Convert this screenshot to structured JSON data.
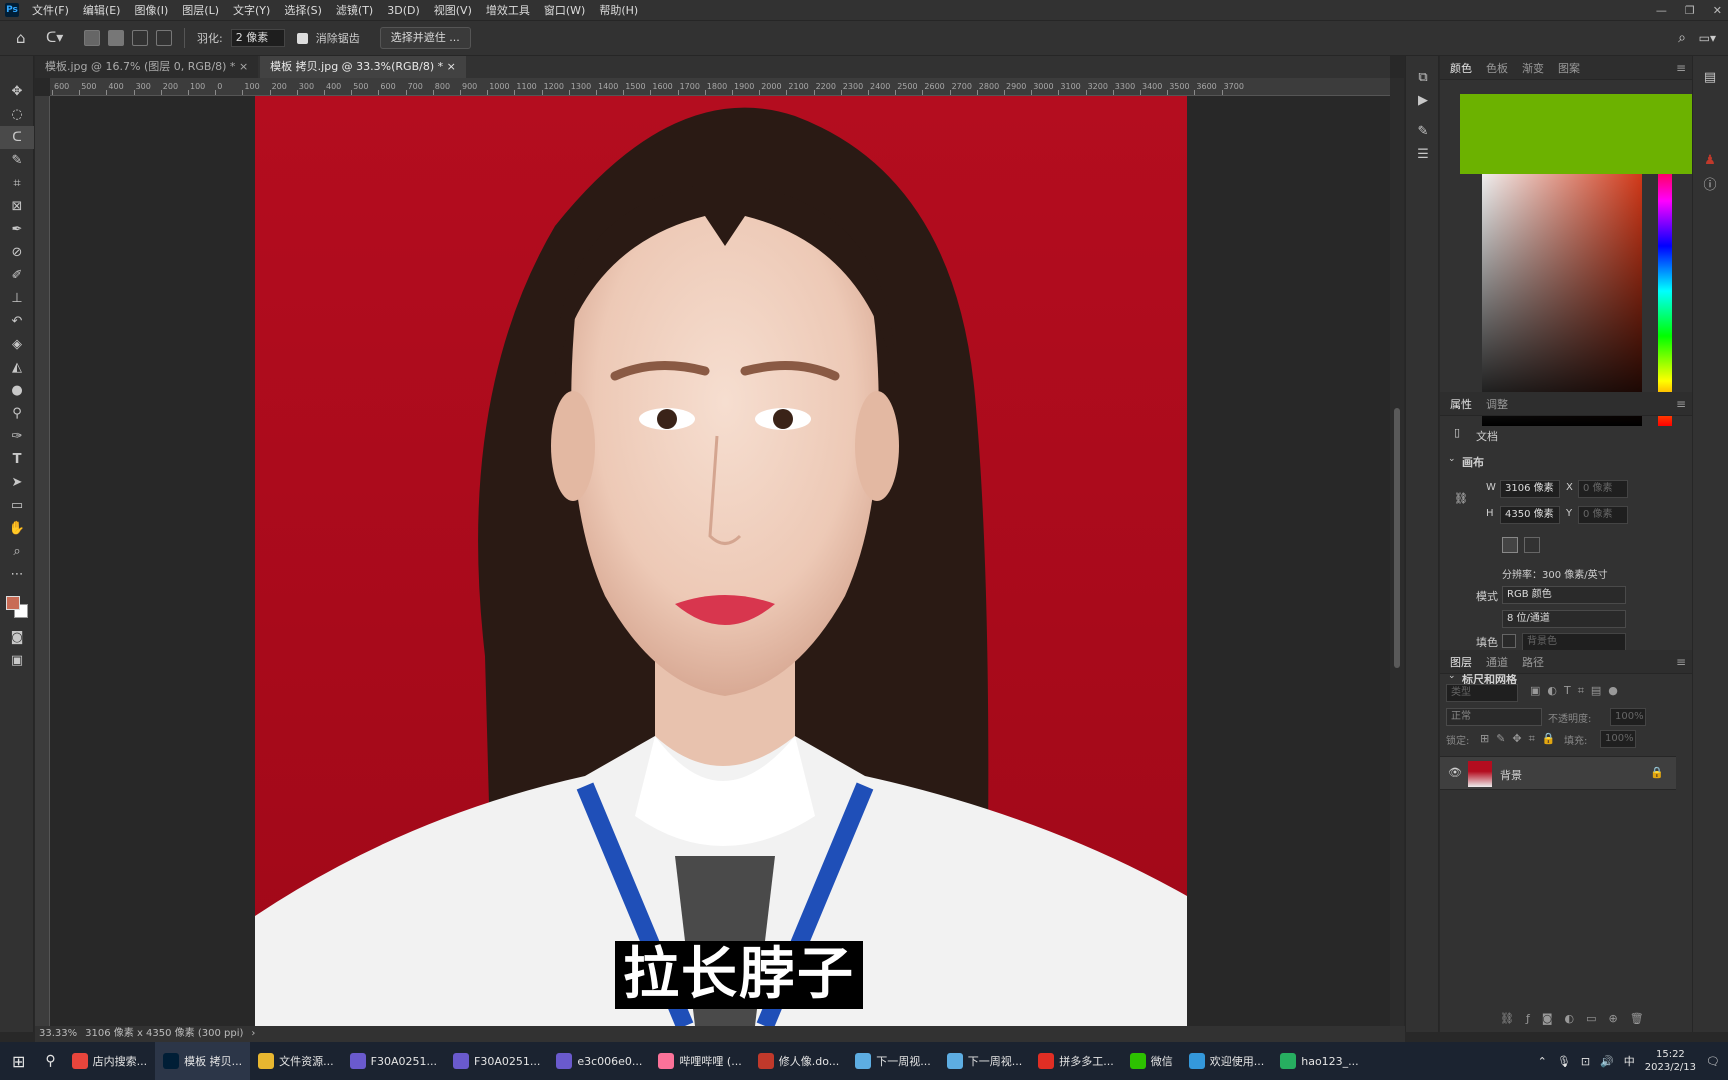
{
  "app": {
    "logo": "Ps"
  },
  "menu": [
    "文件(F)",
    "编辑(E)",
    "图像(I)",
    "图层(L)",
    "文字(Y)",
    "选择(S)",
    "滤镜(T)",
    "3D(D)",
    "视图(V)",
    "增效工具",
    "窗口(W)",
    "帮助(H)"
  ],
  "options": {
    "feather_label": "羽化:",
    "feather_value": "2 像素",
    "antialias_label": "消除锯齿",
    "select_mask_button": "选择并遮住 ..."
  },
  "tabs": [
    {
      "label": "模板.jpg @ 16.7% (图层 0, RGB/8) *"
    },
    {
      "label": "模板 拷贝.jpg @ 33.3%(RGB/8) *"
    }
  ],
  "ruler_h": [
    "600",
    "500",
    "400",
    "300",
    "200",
    "100",
    "0",
    "100",
    "200",
    "300",
    "400",
    "500",
    "600",
    "700",
    "800",
    "900",
    "1000",
    "1100",
    "1200",
    "1300",
    "1400",
    "1500",
    "1600",
    "1700",
    "1800",
    "1900",
    "2000",
    "2100",
    "2200",
    "2300",
    "2400",
    "2500",
    "2600",
    "2700",
    "2800",
    "2900",
    "3000",
    "3100",
    "3200",
    "3300",
    "3400",
    "3500",
    "3600",
    "3700"
  ],
  "subtitle": "拉长脖子",
  "status": {
    "zoom": "33.33%",
    "doc_info": "3106 像素 x 4350 像素 (300 ppi)"
  },
  "color_panel": {
    "tabs": [
      "颜色",
      "色板",
      "渐变",
      "图案"
    ],
    "overlay_color": "#6cb200"
  },
  "properties": {
    "tabs": [
      "属性",
      "调整"
    ],
    "doc_label": "文档",
    "canvas_section": "画布",
    "w_label": "W",
    "w_value": "3106 像素",
    "h_label": "H",
    "h_value": "4350 像素",
    "x_label": "X",
    "x_value": "0 像素",
    "y_label": "Y",
    "y_value": "0 像素",
    "resolution": "分辨率：300 像素/英寸",
    "mode_label": "模式",
    "mode_value": "RGB 颜色",
    "depth_value": "8 位/通道",
    "fill_label": "填色",
    "fill_value": "背景色",
    "rulers_section": "标尺和网格"
  },
  "layers": {
    "tabs": [
      "图层",
      "通道",
      "路径"
    ],
    "search_placeholder": "类型",
    "blend_mode": "正常",
    "opacity_label": "不透明度:",
    "opacity_value": "100%",
    "lock_label": "锁定:",
    "fill_label": "填充:",
    "fill_value": "100%",
    "items": [
      {
        "name": "背景"
      }
    ]
  },
  "taskbar": {
    "apps": [
      {
        "label": "店内搜索...",
        "icon": "chrome-icon",
        "color": "#e8453c"
      },
      {
        "label": "模板 拷贝...",
        "icon": "photoshop-icon",
        "color": "#001e36",
        "active": true
      },
      {
        "label": "文件资源...",
        "icon": "folder-icon",
        "color": "#e8b730"
      },
      {
        "label": "F30A0251...",
        "icon": "image-icon",
        "color": "#6a5acd"
      },
      {
        "label": "F30A0251...",
        "icon": "image-icon",
        "color": "#6a5acd"
      },
      {
        "label": "e3c006e0...",
        "icon": "image-icon",
        "color": "#6a5acd"
      },
      {
        "label": "哔哩哔哩 (...",
        "icon": "bilibili-icon",
        "color": "#fb7299"
      },
      {
        "label": "修人像.do...",
        "icon": "word-icon",
        "color": "#c0392b"
      },
      {
        "label": "下一周视...",
        "icon": "notepad-icon",
        "color": "#5dade2"
      },
      {
        "label": "下一周视...",
        "icon": "notepad-icon",
        "color": "#5dade2"
      },
      {
        "label": "拼多多工...",
        "icon": "pdd-icon",
        "color": "#e02e24"
      },
      {
        "label": "微信",
        "icon": "wechat-icon",
        "color": "#2dc100"
      },
      {
        "label": "欢迎使用...",
        "icon": "app-icon",
        "color": "#3498db"
      },
      {
        "label": "hao123_...",
        "icon": "browser-icon",
        "color": "#27ae60"
      }
    ],
    "ime": "中",
    "time": "15:22",
    "date": "2023/2/13"
  }
}
